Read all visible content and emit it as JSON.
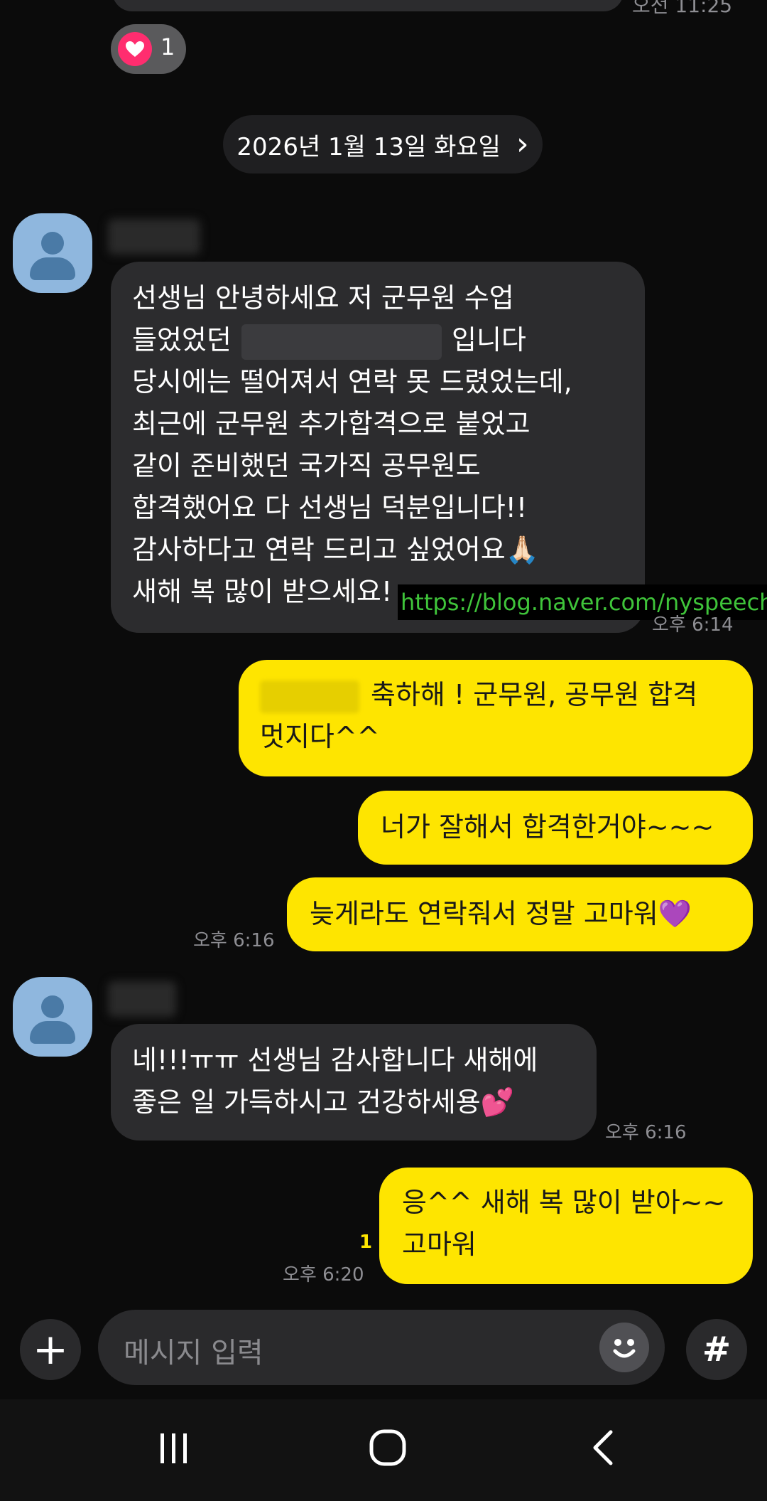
{
  "top": {
    "timestamp": "오전 11:25",
    "reaction_count": "1"
  },
  "date_divider": {
    "label": "2026년 1월 13일 화요일",
    "chevron": "›"
  },
  "watermark": "https://blog.naver.com/nyspeech",
  "messages": {
    "m1": {
      "lines": [
        "선생님 안녕하세요 저 군무원 수업",
        "입니다",
        "당시에는 떨어져서 연락 못 드렸었는데,",
        "최근에 군무원 추가합격으로 붙었고",
        "같이 준비했던 국가직 공무원도",
        "합격했어요 다 선생님 덕분입니다!!",
        "감사하다고 연락 드리고 싶었어요🙏🏻",
        "새해 복 많이 받으세요!"
      ],
      "line2_prefix": "들었었던",
      "time": "오후 6:14"
    },
    "m2": {
      "line1": "축하해 ! 군무원, 공무원 합격",
      "line2": "멋지다^^"
    },
    "m3": {
      "text": "너가 잘해서 합격한거야~~~"
    },
    "m4": {
      "text": "늦게라도 연락줘서 정말 고마워💜",
      "time": "오후 6:16"
    },
    "m5": {
      "line1": "네!!!ㅠㅠ 선생님 감사합니다 새해에",
      "line2": "좋은 일 가득하시고 건강하세용💕",
      "time": "오후 6:16"
    },
    "m6": {
      "line1": "응^^ 새해 복 많이 받아~~",
      "line2": "고마워",
      "time": "오후 6:20",
      "unread": "1"
    }
  },
  "input_bar": {
    "plus": "+",
    "placeholder": "메시지 입력",
    "hash": "#"
  },
  "nav": {
    "recents": "|||",
    "home": "○",
    "back": "‹"
  },
  "colors": {
    "background": "#0b0b0b",
    "incoming": "#2c2c2e",
    "outgoing": "#fee500",
    "heart": "#ff2d6f"
  }
}
